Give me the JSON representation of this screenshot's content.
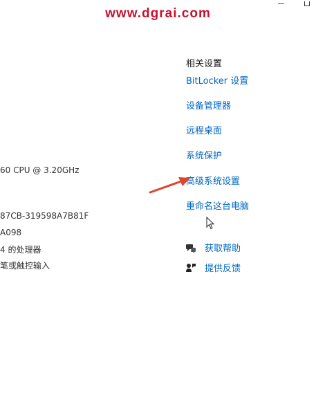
{
  "watermark": "www.dgrai.com",
  "system_specs": {
    "processor": "60  CPU @ 3.20GHz",
    "product_id": "87CB-319598A7B81F",
    "id_suffix": "A098",
    "system_type": "4 的处理器",
    "pen_touch": "笔或触控输入"
  },
  "related_settings": {
    "heading": "相关设置",
    "links": [
      "BitLocker 设置",
      "设备管理器",
      "远程桌面",
      "系统保护",
      "高级系统设置",
      "重命名这台电脑"
    ]
  },
  "support": {
    "get_help": "获取帮助",
    "feedback": "提供反馈"
  },
  "annotation_arrow_color": "#e0442a",
  "icons": [
    "minimize-icon",
    "maximize-icon",
    "help-icon",
    "feedback-icon",
    "mouse-pointer-icon",
    "annotation-arrow-icon"
  ]
}
